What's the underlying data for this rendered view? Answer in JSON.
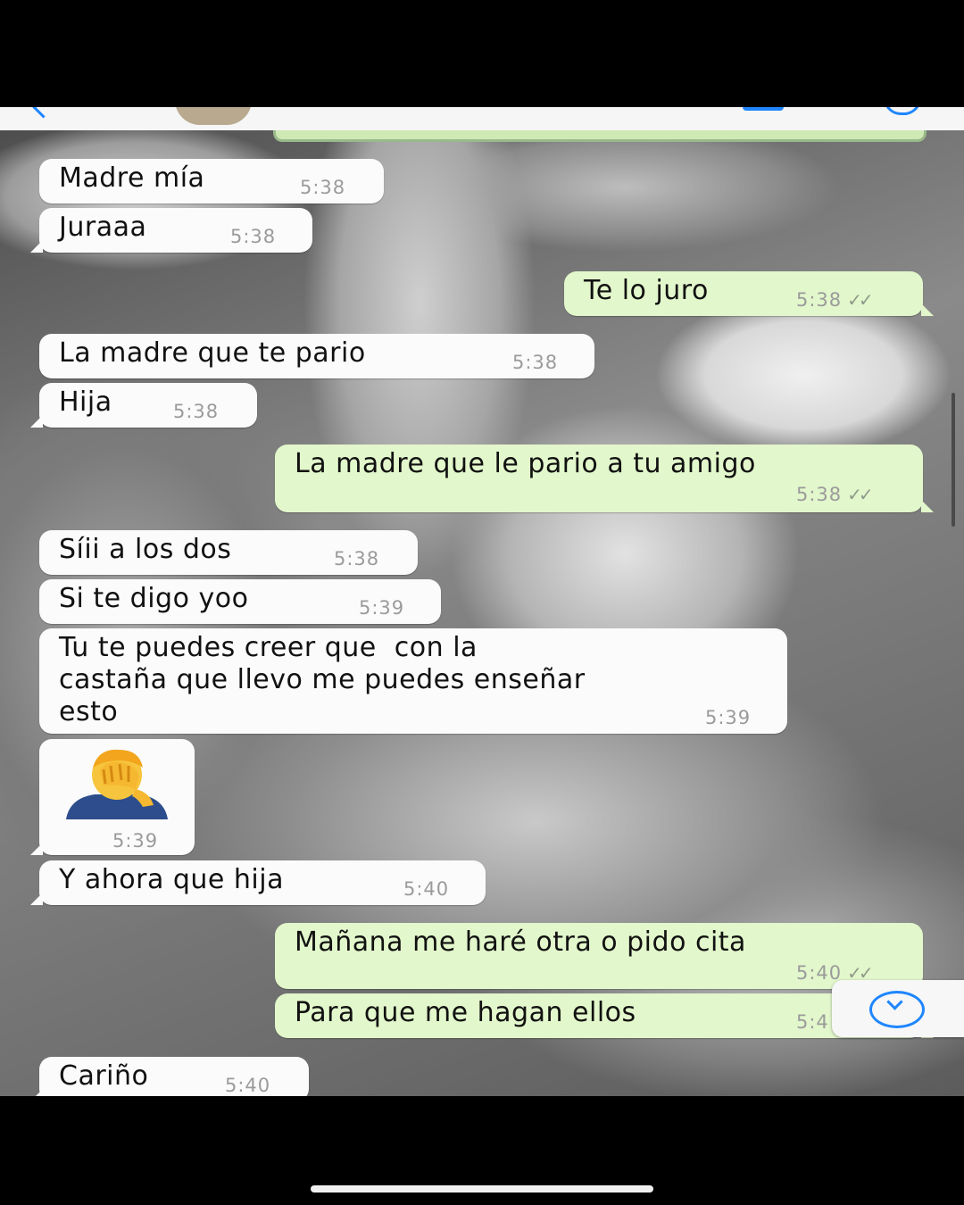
{
  "messages": [
    {
      "direction": "in",
      "text": "Madre mía",
      "time": "5:38"
    },
    {
      "direction": "in",
      "text": "Juraaa",
      "time": "5:38"
    },
    {
      "direction": "out",
      "text": "Te lo juro",
      "time": "5:38",
      "status": "read"
    },
    {
      "direction": "in",
      "text": "La madre que te pario",
      "time": "5:38"
    },
    {
      "direction": "in",
      "text": "Hija",
      "time": "5:38"
    },
    {
      "direction": "out",
      "text": "La madre que le pario a tu amigo",
      "time": "5:38",
      "status": "read"
    },
    {
      "direction": "in",
      "text": "Síii a los dos",
      "time": "5:38"
    },
    {
      "direction": "in",
      "text": "Si te digo yoo",
      "time": "5:39"
    },
    {
      "direction": "in",
      "text": "Tu te puedes creer que  con la\ncastaña que llevo me puedes enseñar\nesto",
      "time": "5:39"
    },
    {
      "direction": "in",
      "emoji": "person-facepalming",
      "time": "5:39"
    },
    {
      "direction": "in",
      "text": "Y ahora que hija",
      "time": "5:40"
    },
    {
      "direction": "out",
      "text": "Mañana me haré otra o pido cita",
      "time": "5:40",
      "status": "read"
    },
    {
      "direction": "out",
      "text": "Para que me hagan ellos",
      "time": "5:4"
    },
    {
      "direction": "in",
      "text": "Cariño",
      "time": "5:40"
    }
  ],
  "status_icons": {
    "read": "double-check-icon"
  },
  "colors": {
    "incoming_bubble": "#fbfbfb",
    "outgoing_bubble": "#e2f7cb",
    "accent": "#1f86ff",
    "timestamp": "#9b9b9b"
  }
}
